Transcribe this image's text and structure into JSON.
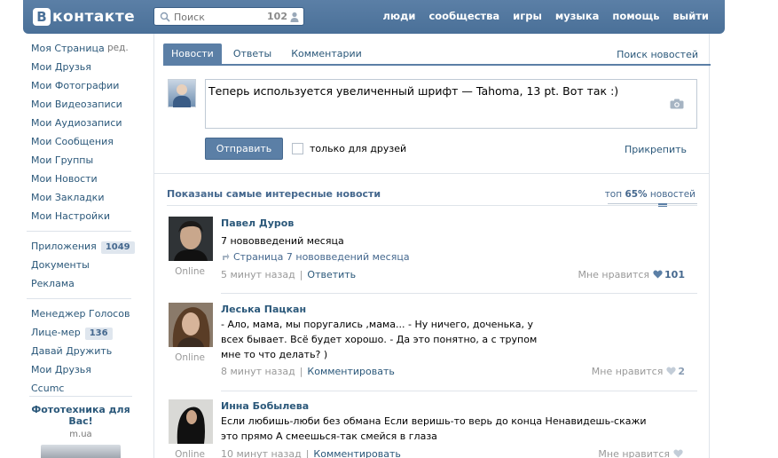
{
  "header": {
    "logo_letter": "В",
    "logo_text": "контакте",
    "search_placeholder": "Поиск",
    "search_count": "102",
    "nav": [
      "люди",
      "сообщества",
      "игры",
      "музыка",
      "помощь",
      "выйти"
    ]
  },
  "sidebar": {
    "edit_label": "ред.",
    "group1": [
      "Моя Страница",
      "Мои Друзья",
      "Мои Фотографии",
      "Мои Видеозаписи",
      "Мои Аудиозаписи",
      "Мои Сообщения",
      "Мои Группы",
      "Мои Новости",
      "Мои Закладки",
      "Мои Настройки"
    ],
    "group2": [
      {
        "label": "Приложения",
        "badge": "1049"
      },
      {
        "label": "Документы",
        "badge": ""
      },
      {
        "label": "Реклама",
        "badge": ""
      }
    ],
    "group3": [
      {
        "label": "Менеджер Голосов",
        "badge": ""
      },
      {
        "label": "Лице-мер",
        "badge": "136"
      },
      {
        "label": "Давай Дружить",
        "badge": ""
      },
      {
        "label": "Мои Друзья",
        "badge": ""
      },
      {
        "label": "Ccumc",
        "badge": ""
      }
    ],
    "ad": {
      "title": "Фототехника для Вас!",
      "domain": "m.ua"
    }
  },
  "tabs": {
    "items": [
      "Новости",
      "Ответы",
      "Комментарии"
    ],
    "active": 0,
    "search_news": "Поиск новостей"
  },
  "composer": {
    "text": "Теперь используется увеличенный шрифт  — Tahoma, 13 pt.  Вот так :)",
    "send_label": "Отправить",
    "friends_only_label": "только для друзей",
    "friends_only_checked": false,
    "attach_label": "Прикрепить"
  },
  "feed": {
    "title": "Показаны самые интересные новости",
    "top_prefix": "топ",
    "top_pct": "65%",
    "top_suffix": "новостей",
    "posts": [
      {
        "author": "Павел Дуров",
        "text": "7 нововведений месяца",
        "repost": "Страница 7 нововведений месяца",
        "online": "Online",
        "time": "5 минут назад",
        "action": "Ответить",
        "like_label": "Мне нравится",
        "like_count": "101"
      },
      {
        "author": "Леська Пацкан",
        "text": "- Ало, мама, мы поругались ,мама... - Ну ничего, доченька, у всех бывает. Всё будет хорошо. - Да это понятно, а с трупом мне то что делать? )",
        "repost": "",
        "online": "Online",
        "time": "8 минут назад",
        "action": "Комментировать",
        "like_label": "Мне нравится",
        "like_count": "2"
      },
      {
        "author": "Инна Бобылева",
        "text": "Если любишь-люби без обмана Если веришь-то верь до конца Ненавидешь-скажи это прямо А смеешься-так смейся в глаза",
        "repost": "",
        "online": "Online",
        "time": "10 минут назад",
        "action": "Комментировать",
        "like_label": "Мне нравится",
        "like_count": ""
      }
    ]
  },
  "colors": {
    "header": "#4a7098",
    "link": "#2b587a",
    "accent": "#5b7fa6"
  }
}
